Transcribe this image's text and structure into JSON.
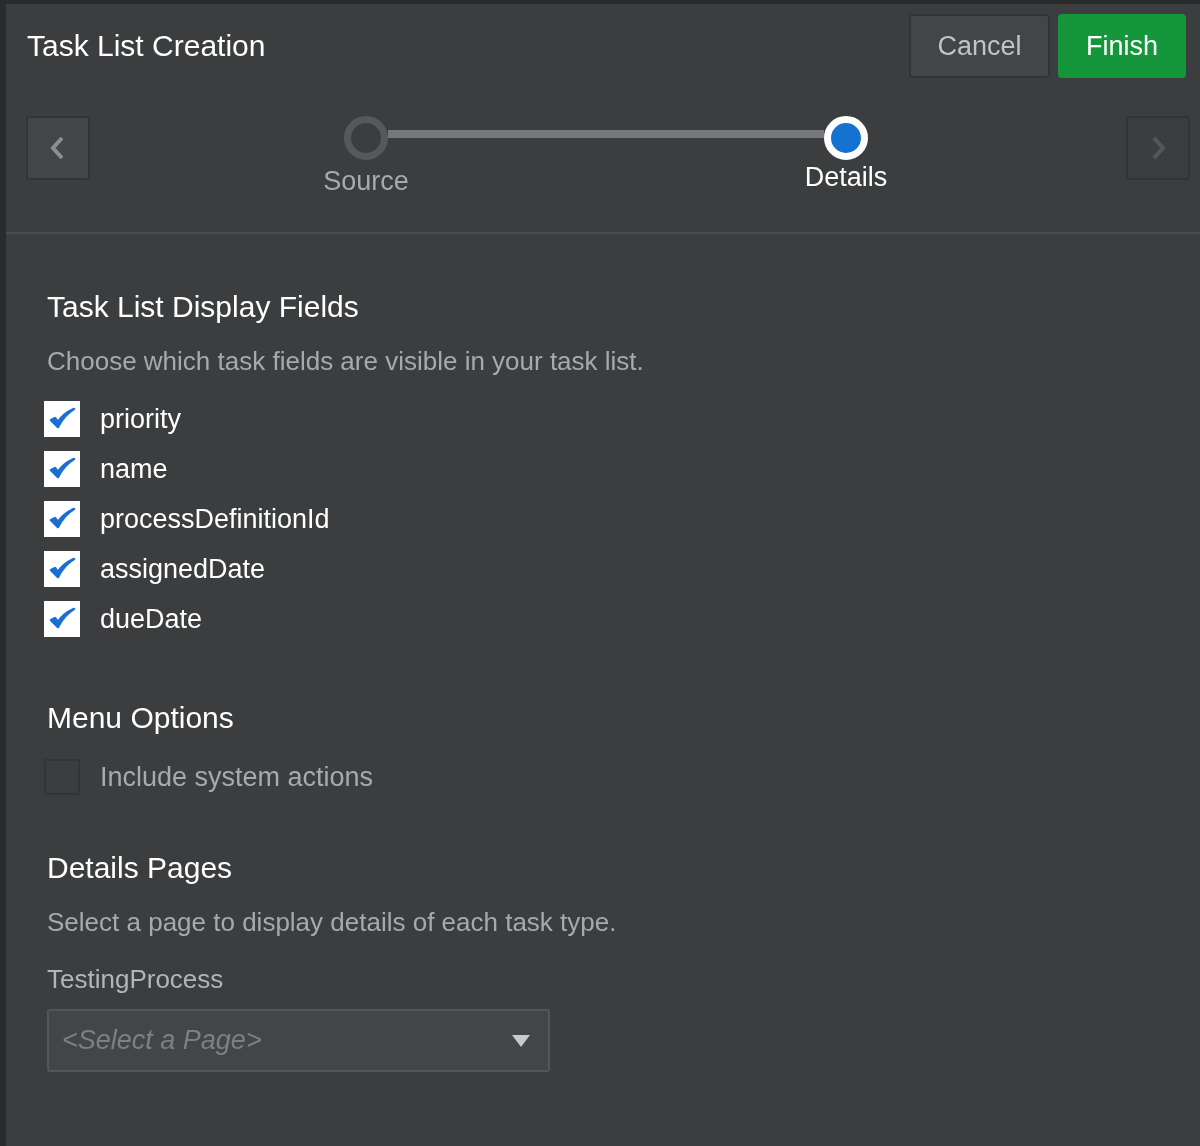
{
  "window": {
    "title": "Task List Creation"
  },
  "buttons": [
    {
      "label": "Cancel",
      "kind": "secondary"
    },
    {
      "label": "Finish",
      "kind": "primary"
    }
  ],
  "navigation": {
    "back_disabled": false,
    "next_disabled": true
  },
  "steps": [
    {
      "label": "Source",
      "selected": false
    },
    {
      "label": "Details",
      "selected": true
    }
  ],
  "display_fields": {
    "heading": "Task List Display Fields",
    "description": "Choose which task fields are visible in your task list.",
    "fields": [
      {
        "label": "priority",
        "checked": true
      },
      {
        "label": "name",
        "checked": true
      },
      {
        "label": "processDefinitionId",
        "checked": true
      },
      {
        "label": "assignedDate",
        "checked": true
      },
      {
        "label": "dueDate",
        "checked": true
      }
    ]
  },
  "menu_options": {
    "heading": "Menu Options",
    "options": [
      {
        "label": "Include system actions",
        "checked": false,
        "disabled": true
      }
    ]
  },
  "details_pages": {
    "heading": "Details Pages",
    "description": "Select a page to display details of each task type.",
    "field_label": "TestingProcess",
    "select": {
      "placeholder": "<Select a Page>"
    }
  }
}
